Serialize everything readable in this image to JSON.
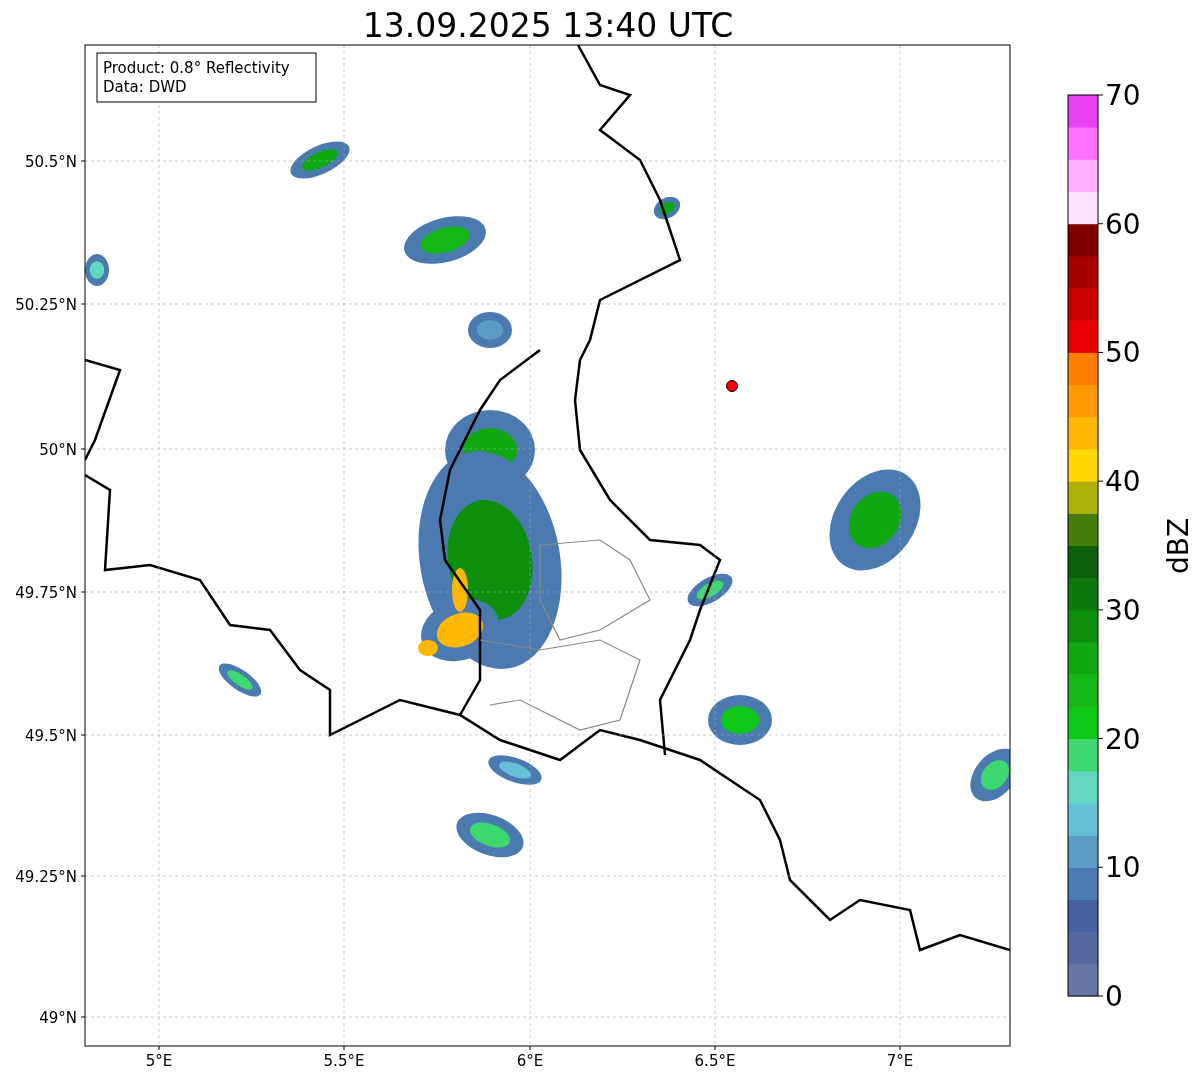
{
  "title": "13.09.2025 13:40 UTC",
  "info_box": {
    "lines": [
      "Product: 0.8° Reflectivity",
      "Data: DWD"
    ]
  },
  "y_ticks": [
    "50.5°N",
    "50.25°N",
    "50°N",
    "49.75°N",
    "49.5°N",
    "49.25°N",
    "49°N"
  ],
  "x_ticks": [
    "5°E",
    "5.5°E",
    "6°E",
    "6.5°E",
    "7°E"
  ],
  "colorbar": {
    "label": "dBZ",
    "ticks": [
      "70",
      "60",
      "50",
      "40",
      "30",
      "20",
      "10",
      "0"
    ],
    "bins": [
      {
        "color": "#6676a6"
      },
      {
        "color": "#5568a0"
      },
      {
        "color": "#4660a0"
      },
      {
        "color": "#4a7ab0"
      },
      {
        "color": "#5a9cc4"
      },
      {
        "color": "#66c0d8"
      },
      {
        "color": "#60d8c0"
      },
      {
        "color": "#3dd870"
      },
      {
        "color": "#10c818"
      },
      {
        "color": "#14b814"
      },
      {
        "color": "#10a810"
      },
      {
        "color": "#0c900c"
      },
      {
        "color": "#0c780c"
      },
      {
        "color": "#0a600a"
      },
      {
        "color": "#467c0a"
      },
      {
        "color": "#b0b00a"
      },
      {
        "color": "#ffd800"
      },
      {
        "color": "#ffb800"
      },
      {
        "color": "#ff9a00"
      },
      {
        "color": "#ff7e00"
      },
      {
        "color": "#e60000"
      },
      {
        "color": "#c80000"
      },
      {
        "color": "#a80000"
      },
      {
        "color": "#800000"
      },
      {
        "color": "#ffe0ff"
      },
      {
        "color": "#ffb0ff"
      },
      {
        "color": "#ff70ff"
      },
      {
        "color": "#e840f0"
      }
    ]
  }
}
